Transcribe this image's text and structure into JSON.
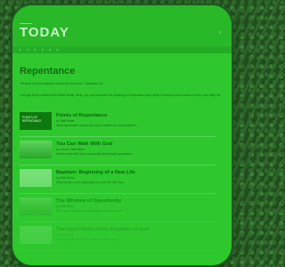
{
  "site": {
    "logo": "TODAY"
  },
  "page": {
    "title": "Repentance",
    "quote": "\"Repent, for the kingdom of heaven is at hand.\" Matthew 3:2",
    "intro": "Through these articles from Bible Study Tools, you can discover the meaning of repentance and what it means to turn toward God in your daily life."
  },
  "articles": [
    {
      "title": "Points of Repentance",
      "author": "by Staff Writer",
      "desc": "What repentance means and why it matters for every believer.",
      "thumb_text": "POINTS OF REPENTANCE",
      "tone": "dark"
    },
    {
      "title": "You Can Walk With God",
      "author": "by John & Staff Writer",
      "desc": "How to walk with God in your daily life through repentance.",
      "thumb_text": "",
      "tone": "mid"
    },
    {
      "title": "Baptism: Beginning of a New Life",
      "author": "by Staff Writer",
      "desc": "Why baptism is the beginning of a new life with God.",
      "thumb_text": "",
      "tone": "light"
    },
    {
      "title": "The Window of Opportunity",
      "author": "by Staff Writer",
      "desc": "God opens a window of opportunity for repentance.",
      "thumb_text": "",
      "tone": "mid"
    },
    {
      "title": "The Good News of the Kingdom of God",
      "author": "by Staff Writer",
      "desc": "The gospel of the kingdom and the call to repent.",
      "thumb_text": "",
      "tone": "light"
    }
  ],
  "colors": {
    "screen": "#2ec82e",
    "frame": "#0f7a0f"
  }
}
